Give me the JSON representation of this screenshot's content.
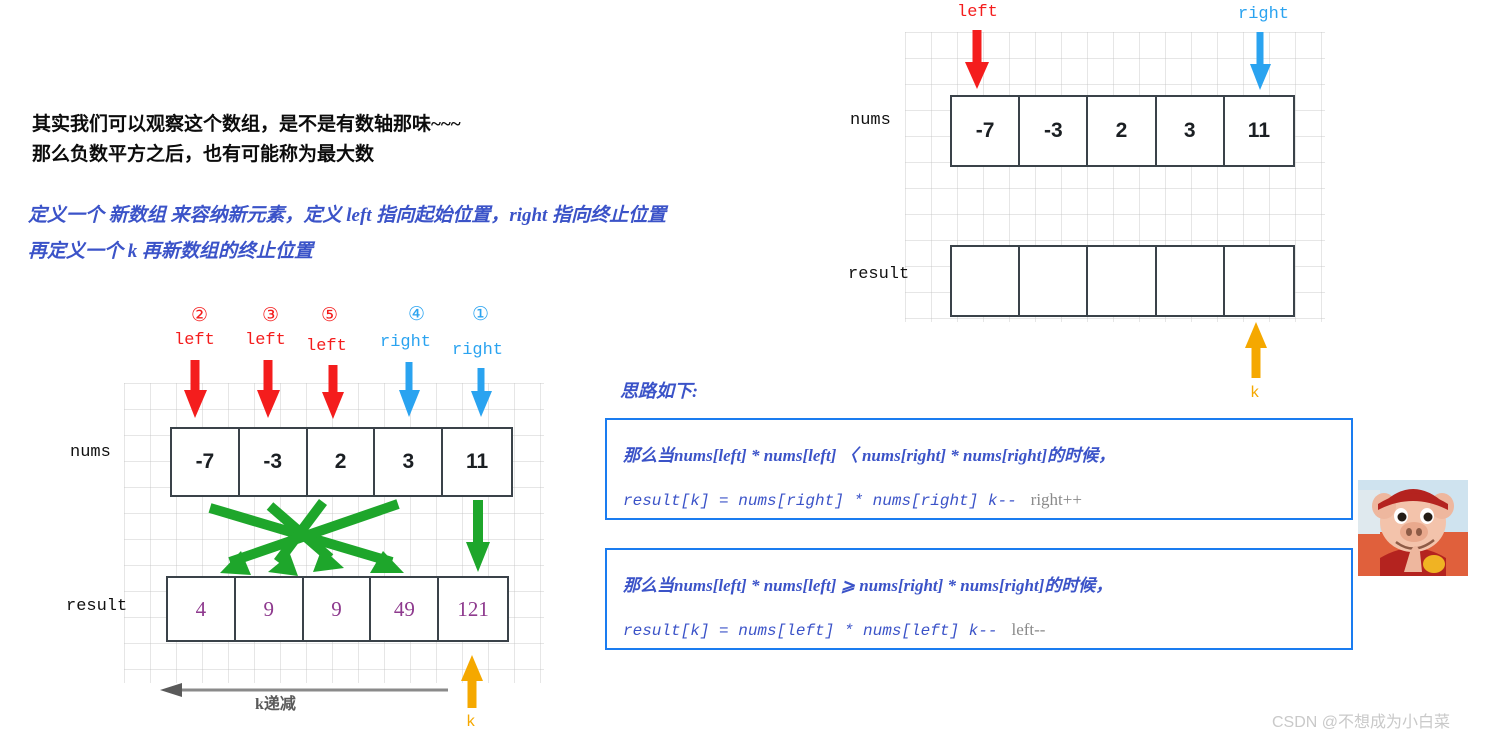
{
  "notes": {
    "line1": "其实我们可以观察这个数组，是不是有数轴那味~~~",
    "line2": "那么负数平方之后，也有可能称为最大数",
    "def_line1": "定义一个 新数组 来容纳新元素，定义 left 指向起始位置，right 指向终止位置",
    "def_line2": "再定义一个 k 再新数组的终止位置",
    "idea_heading": "思路如下:"
  },
  "top_diagram": {
    "nums_label": "nums",
    "result_label": "result",
    "nums_values": [
      "-7",
      "-3",
      "2",
      "3",
      "11"
    ],
    "result_values": [
      "",
      "",
      "",
      "",
      ""
    ],
    "left_pointer": "left",
    "right_pointer": "right",
    "k_pointer": "k"
  },
  "bottom_diagram": {
    "nums_label": "nums",
    "result_label": "result",
    "nums_values": [
      "-7",
      "-3",
      "2",
      "3",
      "11"
    ],
    "result_values": [
      "4",
      "9",
      "9",
      "49",
      "121"
    ],
    "pointers": [
      {
        "step": "②",
        "name": "left",
        "kind": "left"
      },
      {
        "step": "③",
        "name": "left",
        "kind": "left"
      },
      {
        "step": "⑤",
        "name": "left",
        "kind": "left"
      },
      {
        "step": "④",
        "name": "right",
        "kind": "right"
      },
      {
        "step": "①",
        "name": "right",
        "kind": "right"
      }
    ],
    "k_pointer": "k",
    "k_axis_label": "k递减"
  },
  "rules": [
    {
      "condition": "那么当nums[left] * nums[left] 〈 nums[right] * nums[right]的时候，",
      "action": "result[k] = nums[right] * nums[right]  k--",
      "note": "right++"
    },
    {
      "condition": "那么当nums[left] * nums[left] ⩾ nums[right] * nums[right]的时候，",
      "action": "result[k] = nums[left] * nums[left]  k--",
      "note": "left--"
    }
  ],
  "watermark": "CSDN @不想成为小白菜",
  "colors": {
    "left_arrow": "#f41d1d",
    "right_arrow": "#2aa3f0",
    "k_arrow": "#f5a800",
    "map_arrow": "#1ea62b",
    "box_border": "#1a7cf0",
    "result_text": "#8e3a8e",
    "blue_text": "#3b53c8"
  }
}
